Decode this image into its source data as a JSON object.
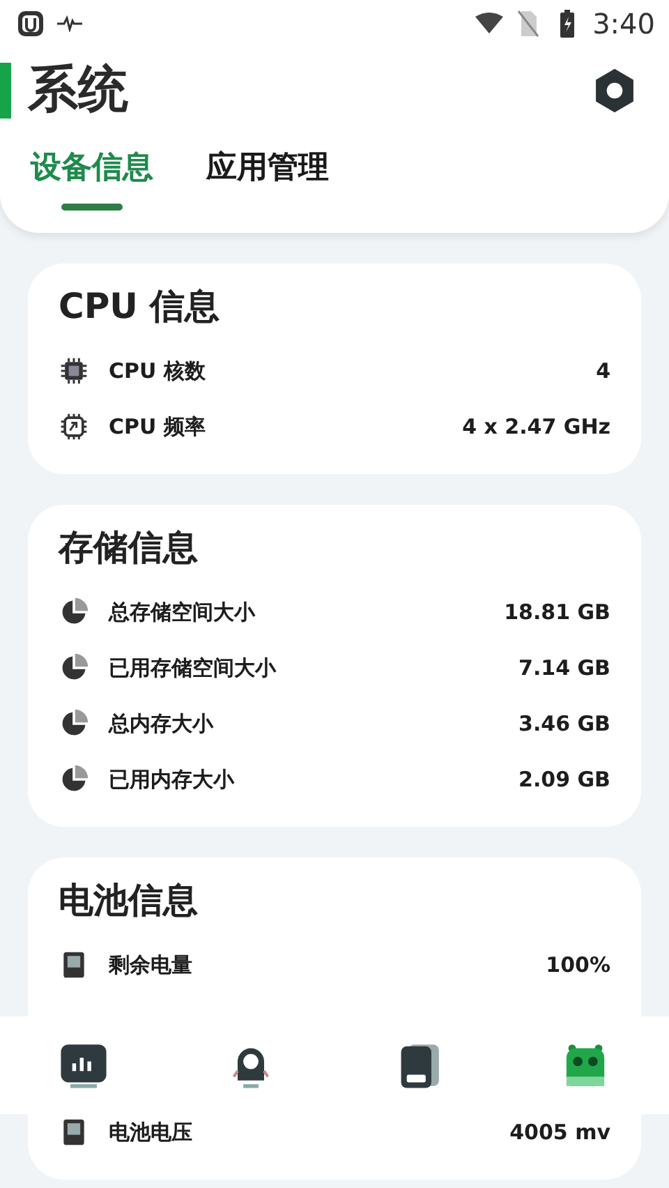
{
  "status_bar": {
    "time": "3:40"
  },
  "header": {
    "title": "系统"
  },
  "tabs": [
    {
      "label": "设备信息",
      "selected": true
    },
    {
      "label": "应用管理",
      "selected": false
    }
  ],
  "cards": [
    {
      "title": "CPU 信息",
      "rows": [
        {
          "kind": "chip",
          "label": "CPU 核数",
          "value": "4"
        },
        {
          "kind": "gauge",
          "label": "CPU 频率",
          "value": "4 x 2.47 GHz"
        }
      ]
    },
    {
      "title": "存储信息",
      "rows": [
        {
          "kind": "pie",
          "label": "总存储空间大小",
          "value": "18.81 GB"
        },
        {
          "kind": "pie",
          "label": "已用存储空间大小",
          "value": "7.14 GB"
        },
        {
          "kind": "pie",
          "label": "总内存大小",
          "value": "3.46 GB"
        },
        {
          "kind": "pie",
          "label": "已用内存大小",
          "value": "2.09 GB"
        }
      ]
    },
    {
      "title": "电池信息",
      "rows": [
        {
          "kind": "battery",
          "label": "剩余电量",
          "value": "100%"
        },
        {
          "kind": "covered"
        },
        {
          "kind": "battery",
          "label": "电池电压",
          "value": "4005 mv"
        }
      ]
    }
  ],
  "bottom_nav": [
    {
      "kind": "chart",
      "selected": false
    },
    {
      "kind": "robot",
      "selected": false
    },
    {
      "kind": "phone",
      "selected": false
    },
    {
      "kind": "android",
      "selected": true
    }
  ]
}
